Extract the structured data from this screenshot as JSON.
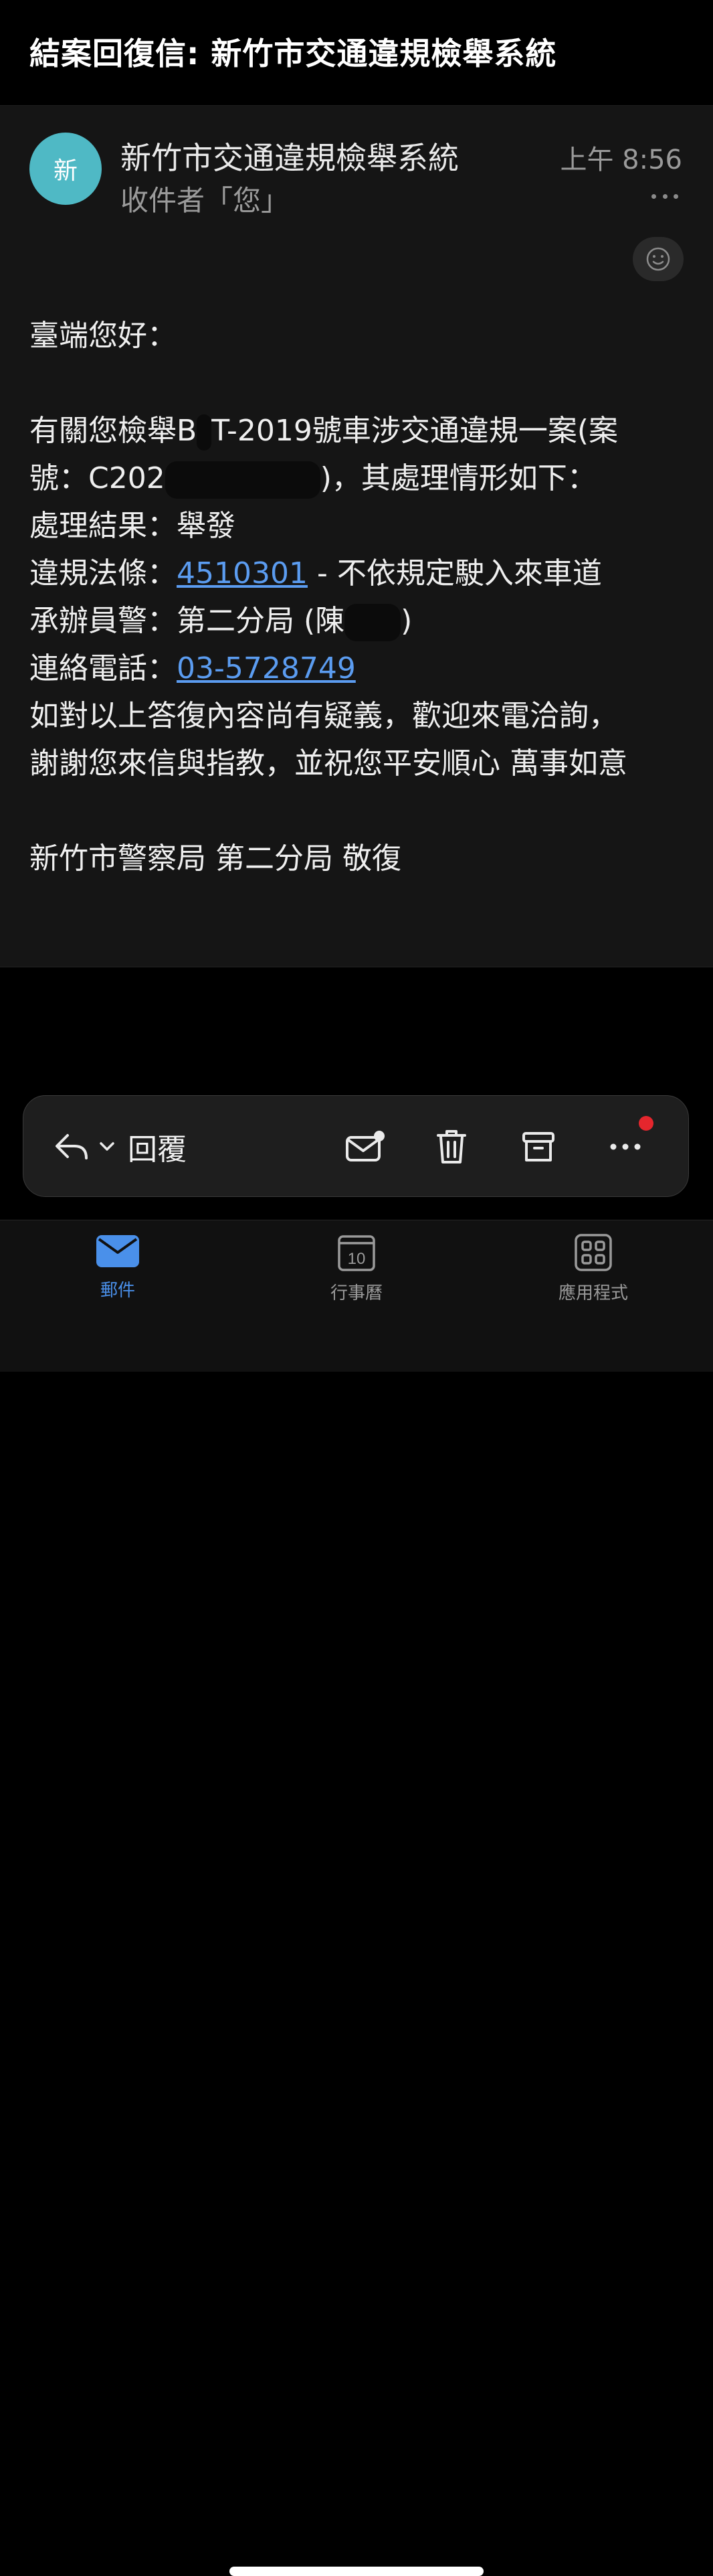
{
  "header": {
    "title": "結案回復信: 新竹市交通違規檢舉系統"
  },
  "message": {
    "avatar_initial": "新",
    "sender": "新竹市交通違規檢舉系統",
    "recipient": "收件者「您」",
    "time": "上午 8:56",
    "body": {
      "greeting": "臺端您好：",
      "p1_a": "有關您檢舉B",
      "p1_b": "T-2019號車涉交通違規一案(案",
      "p2_a": "號：C202",
      "p2_b": ")，其處理情形如下：",
      "result_label": "處理結果：",
      "result_value": "舉發",
      "law_label": "違規法條：",
      "law_code": "4510301",
      "law_desc": " - 不依規定駛入來車道",
      "officer_label": "承辦員警：",
      "officer_value_a": "第二分局 (陳",
      "officer_value_b": ")",
      "phone_label": "連絡電話：",
      "phone_value": "03-5728749",
      "closing1": "如對以上答復內容尚有疑義，歡迎來電洽詢，",
      "closing2": "謝謝您來信與指教，並祝您平安順心 萬事如意",
      "signature": "新竹市警察局 第二分局 敬復"
    }
  },
  "actions": {
    "reply_label": "回覆",
    "icons": [
      "reply-icon",
      "chevron-down-icon",
      "mark-unread-icon",
      "trash-icon",
      "archive-icon",
      "more-icon"
    ]
  },
  "tabs": [
    {
      "label": "郵件",
      "icon": "mail-icon",
      "active": true
    },
    {
      "label": "行事曆",
      "icon": "calendar-icon",
      "day": "10",
      "active": false
    },
    {
      "label": "應用程式",
      "icon": "apps-grid-icon",
      "active": false
    }
  ],
  "colors": {
    "accent": "#4a90ea",
    "avatar": "#4fb9c5",
    "link": "#5b9cf0",
    "badge": "#e5262d"
  }
}
